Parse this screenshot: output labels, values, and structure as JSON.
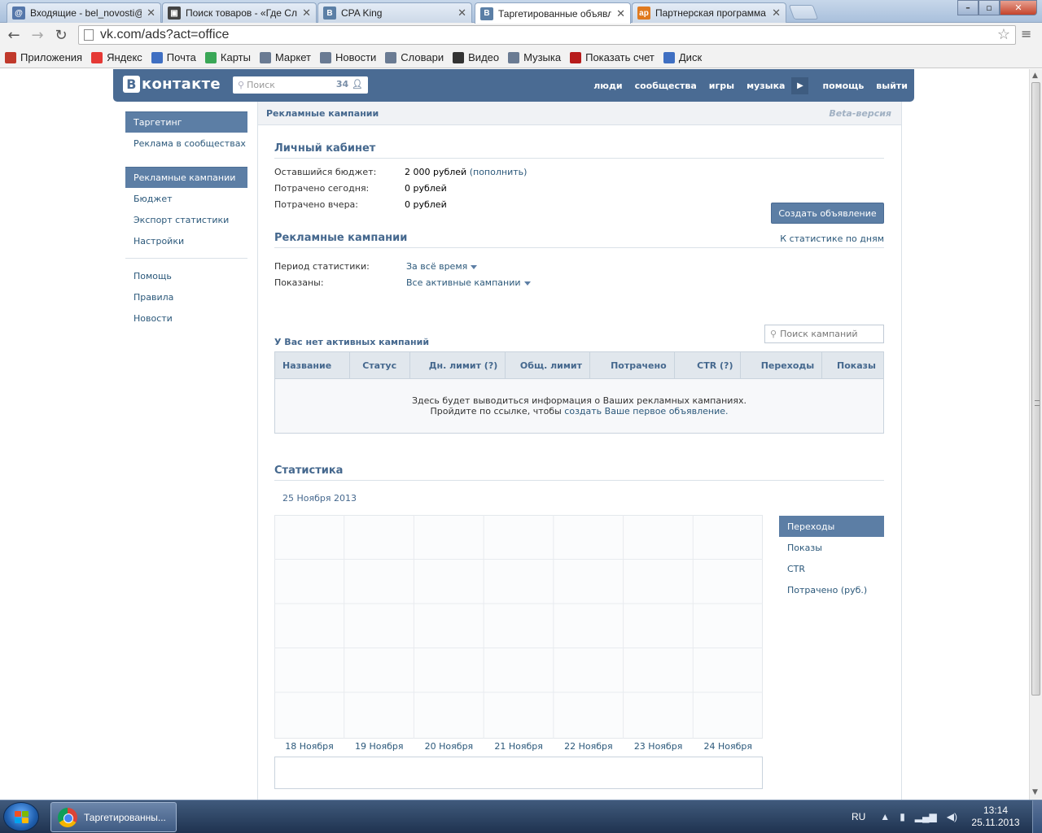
{
  "browser": {
    "tabs": [
      {
        "title": "Входящие - bel_novosti@",
        "icon": "mail-icon",
        "color": "#5577aa",
        "glyph": "@"
      },
      {
        "title": "Поиск товаров - «Где Сл",
        "icon": "shop-icon",
        "color": "#444444",
        "glyph": "▣"
      },
      {
        "title": "CPA King",
        "icon": "vk-icon",
        "color": "#5b7fa6",
        "glyph": "B"
      },
      {
        "title": "Таргетированные объявл",
        "icon": "vk-icon",
        "color": "#5b7fa6",
        "glyph": "B"
      },
      {
        "title": "Партнерская программа",
        "icon": "ap-icon",
        "color": "#e07a1f",
        "glyph": "ap"
      }
    ],
    "url": "vk.com/ads?act=office",
    "bookmarks": [
      {
        "label": "Приложения",
        "icon": "apps-grid-icon",
        "color": "#c0392b"
      },
      {
        "label": "Яндекс",
        "icon": "yandex-icon",
        "color": "#e53935"
      },
      {
        "label": "Почта",
        "icon": "mail-icon",
        "color": "#3f6fc2"
      },
      {
        "label": "Карты",
        "icon": "maps-icon",
        "color": "#3aa757"
      },
      {
        "label": "Маркет",
        "icon": "market-icon",
        "color": "#6a7b93"
      },
      {
        "label": "Новости",
        "icon": "news-icon",
        "color": "#6a7b93"
      },
      {
        "label": "Словари",
        "icon": "dictionary-icon",
        "color": "#6a7b93"
      },
      {
        "label": "Видео",
        "icon": "video-icon",
        "color": "#333333"
      },
      {
        "label": "Музыка",
        "icon": "music-icon",
        "color": "#6a7b93"
      },
      {
        "label": "Показать счет",
        "icon": "webmoney-icon",
        "color": "#b71c1c"
      },
      {
        "label": "Диск",
        "icon": "disk-icon",
        "color": "#3f6fc2"
      }
    ]
  },
  "vk": {
    "logo": "контакте",
    "logo_letter": "В",
    "search_placeholder": "Поиск",
    "search_count": "34",
    "nav": [
      "люди",
      "сообщества",
      "игры",
      "музыка",
      "помощь",
      "выйти"
    ]
  },
  "left_menu": {
    "group1": [
      {
        "label": "Таргетинг",
        "selected": true
      },
      {
        "label": "Реклама в сообществах",
        "selected": false
      }
    ],
    "group2": [
      {
        "label": "Рекламные кампании",
        "selected": true
      },
      {
        "label": "Бюджет",
        "selected": false
      },
      {
        "label": "Экспорт статистики",
        "selected": false
      },
      {
        "label": "Настройки",
        "selected": false
      }
    ],
    "group3": [
      {
        "label": "Помощь"
      },
      {
        "label": "Правила"
      },
      {
        "label": "Новости"
      }
    ]
  },
  "main": {
    "top_title": "Рекламные кампании",
    "beta": "Beta-версия",
    "cabinet": {
      "title": "Личный кабинет",
      "rows": [
        {
          "label": "Оставшийся бюджет:",
          "value": "2 000 рублей",
          "link": "(пополнить)"
        },
        {
          "label": "Потрачено сегодня:",
          "value": "0 рублей",
          "link": ""
        },
        {
          "label": "Потрачено вчера:",
          "value": "0 рублей",
          "link": ""
        }
      ],
      "create_button": "Создать объявление"
    },
    "campaigns": {
      "title": "Рекламные кампании",
      "stats_link": "К статистике по дням",
      "period_label": "Период статистики:",
      "period_value": "За всё время",
      "shown_label": "Показаны:",
      "shown_value": "Все активные кампании",
      "no_active": "У Вас нет активных кампаний",
      "search_placeholder": "Поиск кампаний",
      "columns": [
        "Название",
        "Статус",
        "Дн. лимит (?)",
        "Общ. лимит",
        "Потрачено",
        "CTR (?)",
        "Переходы",
        "Показы"
      ],
      "empty_line1": "Здесь будет выводиться информация о Ваших рекламных кампаниях.",
      "empty_line2_prefix": "Пройдите по ссылке, чтобы ",
      "empty_line2_link": "создать Ваше первое объявление."
    },
    "stats": {
      "title": "Статистика",
      "date": "25 Ноября 2013",
      "metrics": [
        {
          "label": "Переходы",
          "selected": true
        },
        {
          "label": "Показы",
          "selected": false
        },
        {
          "label": "CTR",
          "selected": false
        },
        {
          "label": "Потрачено (руб.)",
          "selected": false
        }
      ]
    }
  },
  "chart_data": {
    "type": "line",
    "categories": [
      "18 Ноября",
      "19 Ноября",
      "20 Ноября",
      "21 Ноября",
      "22 Ноября",
      "23 Ноября",
      "24 Ноября"
    ],
    "series": [],
    "grid": true
  },
  "taskbar": {
    "task_label": "Таргетированны...",
    "lang": "RU",
    "time": "13:14",
    "date": "25.11.2013"
  }
}
